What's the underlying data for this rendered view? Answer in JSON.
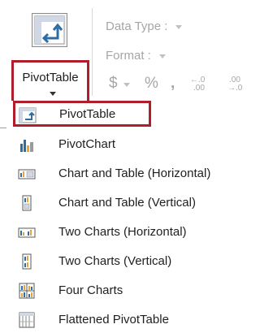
{
  "ribbon": {
    "pivot_button_label": "PivotTable",
    "data_type_label": "Data Type :",
    "format_label": "Format :",
    "currency_symbol": "$",
    "percent_symbol": "%",
    "comma_symbol": ",",
    "increase_decimal_top": "←.0",
    "increase_decimal_bottom": ".00",
    "decrease_decimal_top": ".00",
    "decrease_decimal_bottom": "→.0"
  },
  "menu": {
    "items": [
      {
        "label": "PivotTable",
        "icon": "pivot-table-icon"
      },
      {
        "label": "PivotChart",
        "icon": "pivot-chart-icon"
      },
      {
        "label": "Chart and Table (Horizontal)",
        "icon": "chart-table-horizontal-icon"
      },
      {
        "label": "Chart and Table (Vertical)",
        "icon": "chart-table-vertical-icon"
      },
      {
        "label": "Two Charts (Horizontal)",
        "icon": "two-charts-horizontal-icon"
      },
      {
        "label": "Two Charts (Vertical)",
        "icon": "two-charts-vertical-icon"
      },
      {
        "label": "Four Charts",
        "icon": "four-charts-icon"
      },
      {
        "label": "Flattened PivotTable",
        "icon": "flattened-pivot-icon"
      }
    ]
  },
  "colors": {
    "highlight_border": "#b01e2a",
    "disabled_text": "#a6a6a6",
    "icon_blue": "#2e6da4",
    "icon_orange": "#e8a33d"
  }
}
